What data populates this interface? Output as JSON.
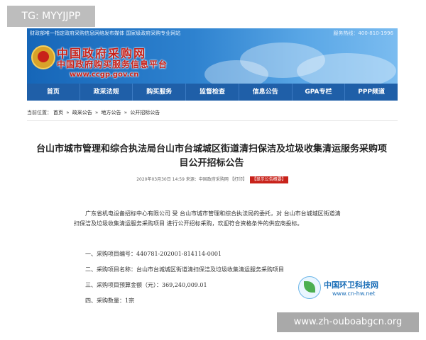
{
  "overlay": {
    "tg_label": "TG: MYYJJPP",
    "site_url_banner": "www.zh-ouboabgcn.org"
  },
  "header": {
    "top_left_text": "财政部唯一指定政府采购信息网络发布媒体 国家级政府采购专业网站",
    "top_right_text": "服务热线：400-810-1996",
    "logo_title": "中国政府采购网",
    "logo_subtitle": "中国政府购买服务信息平台",
    "logo_url": "www.ccgp.gov.cn"
  },
  "nav": {
    "items": [
      "首页",
      "政采法规",
      "购买服务",
      "监督检查",
      "信息公告",
      "GPA专栏",
      "PPP频道"
    ]
  },
  "breadcrumb": {
    "prefix": "当前位置：",
    "items": [
      "首页",
      "»",
      "政采公告",
      "»",
      "地方公告",
      "»",
      "公开招标公告"
    ]
  },
  "article": {
    "title": "台山市城市管理和综合执法局台山市台城城区街道清扫保洁及垃圾收集清运服务采购项目公开招标公告",
    "meta": "2020年03月30日 14:59 来源：中国政府采购网 【打印】",
    "meta_tag": "【显示公告概要】",
    "intro": "广东省机电设备招标中心有限公司 受 台山市城市管理和综合执法局的委托，对 台山市台城城区街道清扫保洁及垃圾收集清运服务采购项目 进行公开招标采购，欢迎符合资格条件的供应商投标。",
    "items": [
      "一、采购项目编号：440781-202001-814114-0001",
      "二、采购项目名称：台山市台城城区街道清扫保洁及垃圾收集清运服务采购项目",
      "三、采购项目预算金额（元）：369,240,009.01",
      "四、采购数量：1宗"
    ]
  },
  "watermark": {
    "name": "中国环卫科技网",
    "url": "www.cn-hw.net"
  },
  "colors": {
    "nav_bg": "#1f5fa8",
    "header_blue": "#2e82cf",
    "logo_red": "#c8221a",
    "watermark_blue": "#1c6fb8"
  }
}
